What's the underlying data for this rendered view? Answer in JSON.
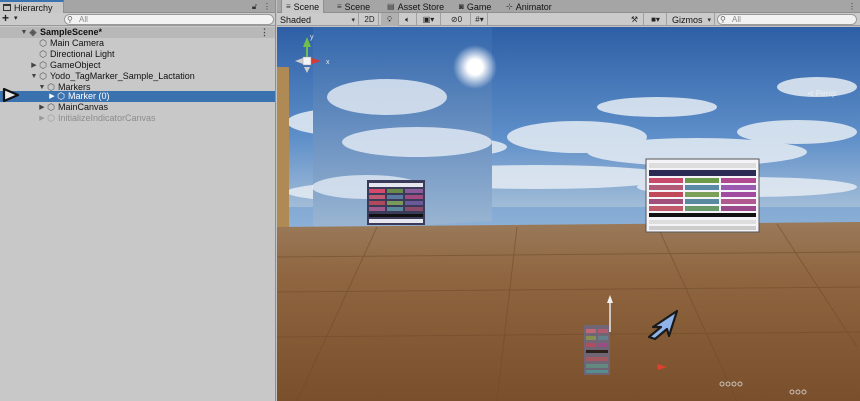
{
  "hierarchy": {
    "tab_label": "Hierarchy",
    "search_placeholder": "All",
    "rows": [
      {
        "label": "SampleScene*"
      },
      {
        "label": "Main Camera"
      },
      {
        "label": "Directional Light"
      },
      {
        "label": "GameObject"
      },
      {
        "label": "Yodo_TagMarker_Sample_Lactation"
      },
      {
        "label": "Markers"
      },
      {
        "label": "Marker (0)"
      },
      {
        "label": "MainCanvas"
      },
      {
        "label": "InitializeIndicatorCanvas"
      }
    ],
    "menu_glyph": "⋮"
  },
  "scene": {
    "tabs": [
      {
        "label": "Scene"
      },
      {
        "label": "Scene"
      },
      {
        "label": "Asset Store"
      },
      {
        "label": "Game"
      },
      {
        "label": "Animator"
      }
    ],
    "draw_mode": "Shaded",
    "mode_2d": "2D",
    "hidden_count": "0",
    "gizmos_label": "Gizmos",
    "search_placeholder": "All",
    "persp_label": "Persp",
    "axis_y": "y",
    "axis_x": "x"
  },
  "colors": {
    "selection": "#3a72b0",
    "panel_bg": "#c8c8c8",
    "sky_top": "#2e5fa6",
    "floor": "#8a5f36",
    "arrow": "#7fa9e6"
  }
}
